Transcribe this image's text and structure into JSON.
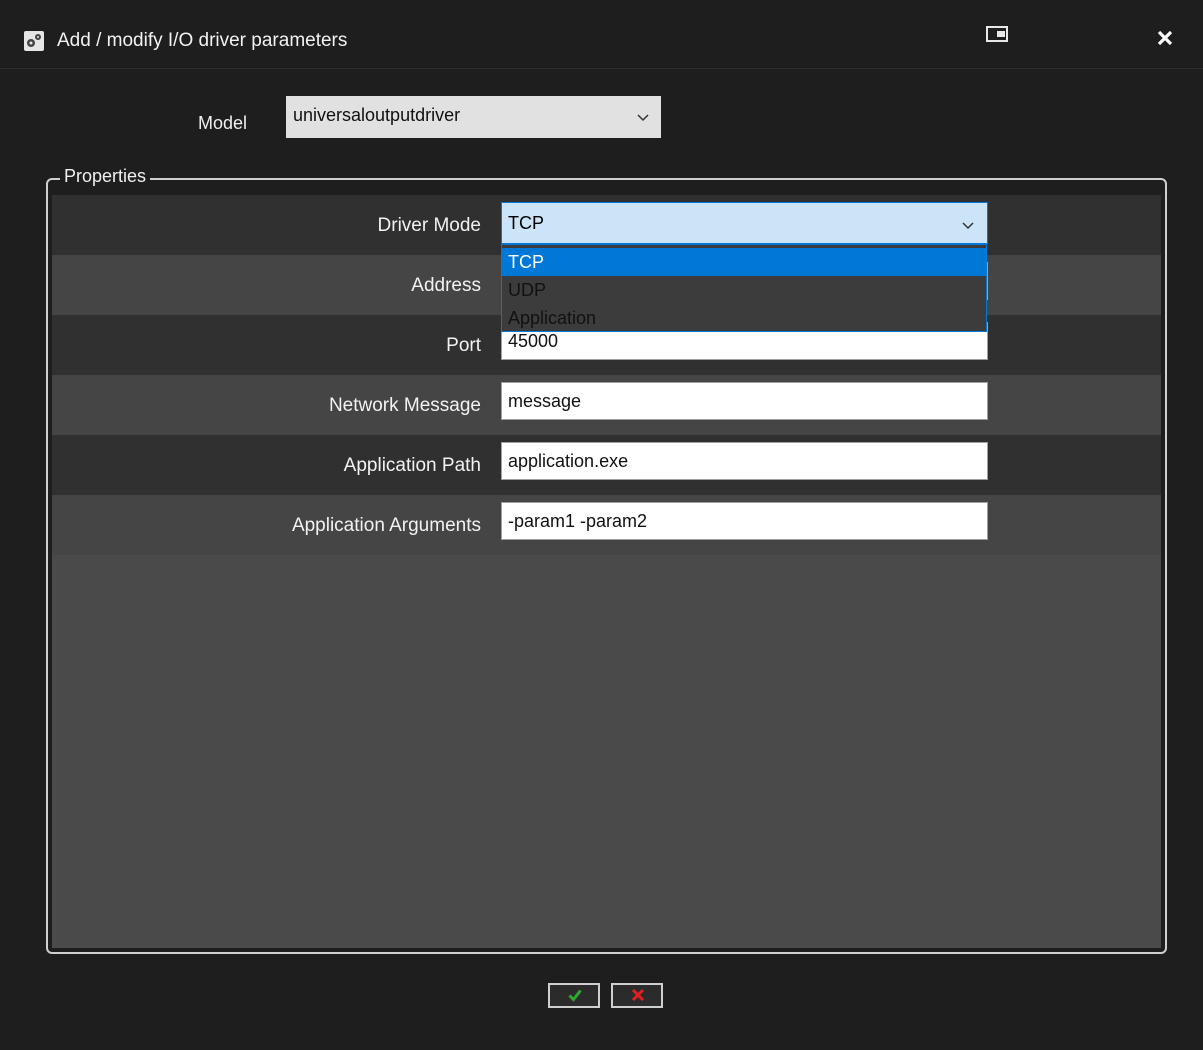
{
  "window": {
    "title": "Add / modify I/O driver parameters",
    "icons": {
      "app": "gears-icon",
      "restore": "restore-window-icon",
      "close": "close-icon"
    }
  },
  "model": {
    "label": "Model",
    "value": "universaloutputdriver"
  },
  "properties": {
    "legend": "Properties",
    "driver_mode": {
      "label": "Driver Mode",
      "value": "TCP",
      "options": [
        "TCP",
        "UDP",
        "Application"
      ],
      "highlighted": "TCP"
    },
    "address": {
      "label": "Address",
      "value": ""
    },
    "port": {
      "label": "Port",
      "value": "45000"
    },
    "network_message": {
      "label": "Network Message",
      "value": "message"
    },
    "application_path": {
      "label": "Application Path",
      "value": "application.exe"
    },
    "application_arguments": {
      "label": "Application Arguments",
      "value": "-param1 -param2"
    }
  },
  "buttons": {
    "ok": {
      "icon": "checkmark-icon",
      "color": "#2fa82f"
    },
    "cancel": {
      "icon": "x-icon",
      "color": "#e02020"
    }
  },
  "colors": {
    "accent": "#0078d7",
    "background": "#1e1e1e",
    "panel": "#4a4a4a"
  }
}
